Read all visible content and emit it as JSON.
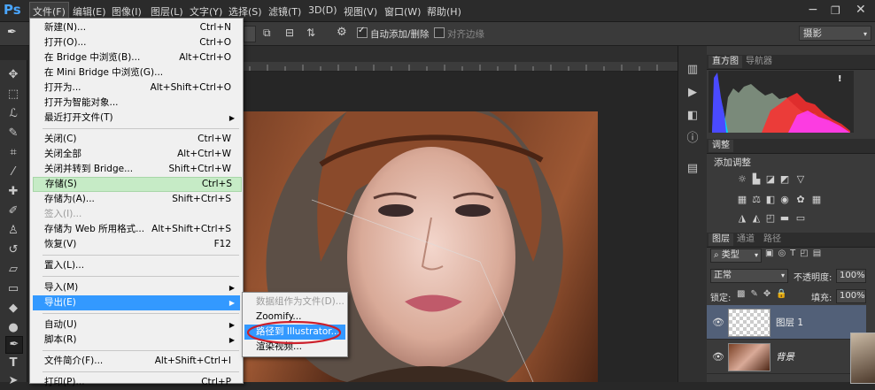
{
  "app": {
    "logo": "Ps"
  },
  "menubar": {
    "items": [
      "文件(F)",
      "编辑(E)",
      "图像(I)",
      "图层(L)",
      "文字(Y)",
      "选择(S)",
      "滤镜(T)",
      "3D(D)",
      "视图(V)",
      "窗口(W)",
      "帮助(H)"
    ],
    "window_controls": {
      "minimize": "−",
      "restore": "❐",
      "close": "✕"
    }
  },
  "options_bar": {
    "auto_add_delete": "自动添加/删除",
    "align_edges": "对齐边缘",
    "workspace": "摄影"
  },
  "file_menu": {
    "items": [
      {
        "label": "新建(N)...",
        "shortcut": "Ctrl+N"
      },
      {
        "label": "打开(O)...",
        "shortcut": "Ctrl+O"
      },
      {
        "label": "在 Bridge 中浏览(B)...",
        "shortcut": "Alt+Ctrl+O"
      },
      {
        "label": "在 Mini Bridge 中浏览(G)...",
        "shortcut": ""
      },
      {
        "label": "打开为...",
        "shortcut": "Alt+Shift+Ctrl+O"
      },
      {
        "label": "打开为智能对象...",
        "shortcut": ""
      },
      {
        "label": "最近打开文件(T)",
        "shortcut": ""
      },
      {
        "label": "关闭(C)",
        "shortcut": "Ctrl+W"
      },
      {
        "label": "关闭全部",
        "shortcut": "Alt+Ctrl+W"
      },
      {
        "label": "关闭并转到 Bridge...",
        "shortcut": "Shift+Ctrl+W"
      },
      {
        "label": "存储(S)",
        "shortcut": "Ctrl+S"
      },
      {
        "label": "存储为(A)...",
        "shortcut": "Shift+Ctrl+S"
      },
      {
        "label": "签入(I)...",
        "shortcut": ""
      },
      {
        "label": "存储为 Web 所用格式...",
        "shortcut": "Alt+Shift+Ctrl+S"
      },
      {
        "label": "恢复(V)",
        "shortcut": "F12"
      },
      {
        "label": "置入(L)...",
        "shortcut": ""
      },
      {
        "label": "导入(M)",
        "shortcut": ""
      },
      {
        "label": "导出(E)",
        "shortcut": ""
      },
      {
        "label": "自动(U)",
        "shortcut": ""
      },
      {
        "label": "脚本(R)",
        "shortcut": ""
      },
      {
        "label": "文件简介(F)...",
        "shortcut": "Alt+Shift+Ctrl+I"
      },
      {
        "label": "打印(P)...",
        "shortcut": "Ctrl+P"
      }
    ]
  },
  "export_submenu": {
    "items": [
      "数据组作为文件(D)...",
      "Zoomify...",
      "路径到 Illustrator...",
      "渲染视频..."
    ]
  },
  "panels": {
    "histogram_tabs": [
      "直方图",
      "导航器"
    ],
    "warning": "!",
    "adjust_tab": "调整",
    "adjust_title": "添加调整",
    "layers_tabs": [
      "图层",
      "通道",
      "路径"
    ],
    "filter_kind": "类型",
    "blend_mode": "正常",
    "opacity_label": "不透明度:",
    "opacity_value": "100%",
    "lock_label": "锁定:",
    "fill_label": "填充:",
    "fill_value": "100%",
    "layers": [
      "图层 1",
      "背景"
    ]
  },
  "colors": {
    "highlight_green": "#c6ebc6",
    "highlight_blue": "#3399ff",
    "annotation_red": "#cc1f2a",
    "ps_blue": "#4aa6ff"
  }
}
